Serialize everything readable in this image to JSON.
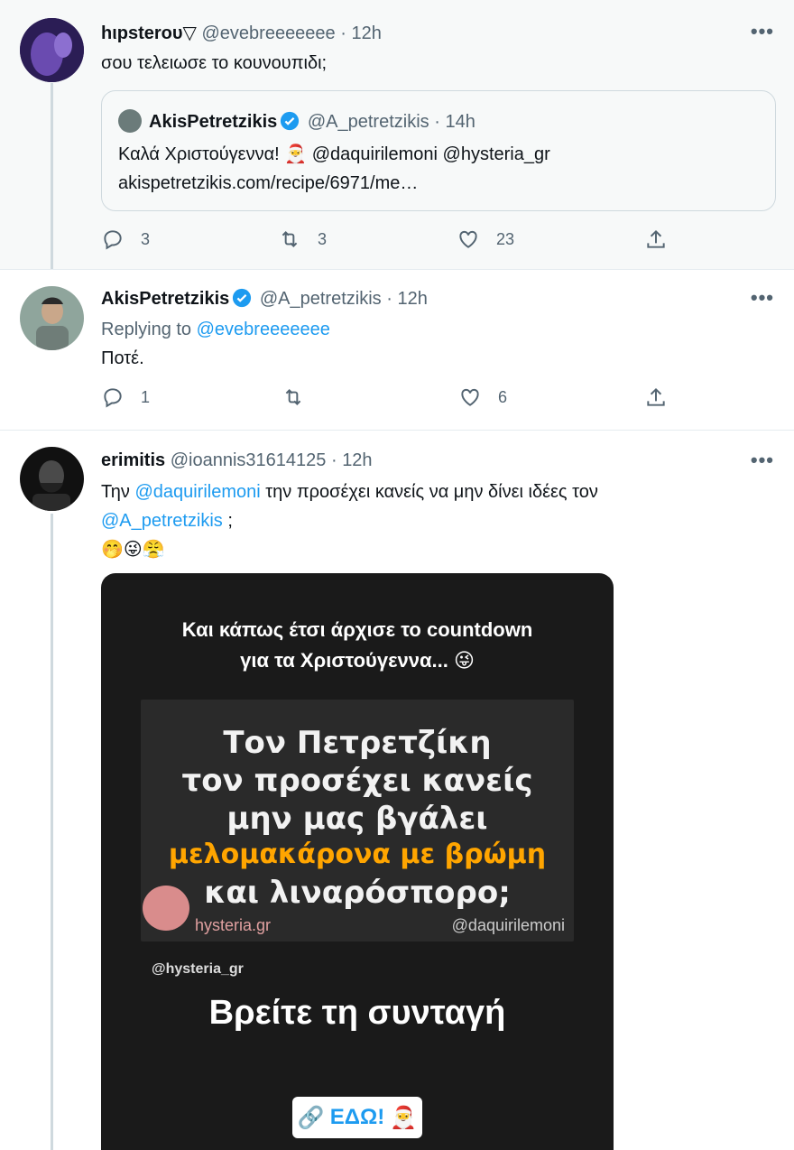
{
  "tweets": [
    {
      "name": "hιpsterου▽",
      "handle": "@evebreeeeeee",
      "time": "12h",
      "text": "σου τελειωσε το κουνουπιδι;",
      "quote": {
        "name": "AkisPetretzikis",
        "handle": "@A_petretzikis",
        "time": "14h",
        "line1": "Καλά Χριστούγεννα! 🎅 @daquirilemoni @hysteria_gr",
        "line2": "akispetretzikis.com/recipe/6971/me…"
      },
      "replies": "3",
      "retweets": "3",
      "likes": "23"
    },
    {
      "name": "AkisPetretzikis",
      "handle": "@A_petretzikis",
      "time": "12h",
      "replying_label": "Replying to",
      "replying_to": "@evebreeeeeee",
      "text": "Ποτέ.",
      "replies": "1",
      "retweets": "",
      "likes": "6"
    },
    {
      "name": "erimitis",
      "handle": "@ioannis31614125",
      "time": "12h",
      "text_pre": "Την",
      "mention1": "@daquirilemoni",
      "text_mid": "την προσέχει κανείς να μην δίνει ιδέες τον",
      "mention2": "@A_petretzikis",
      "text_post": ";",
      "emojis": "🤭😜😤",
      "media": {
        "caption1": "Και κάπως έτσι άρχισε το countdown",
        "caption2": "για τα Χριστούγεννα... 😜",
        "board1": "Τον Πετρετζίκη",
        "board2": "τον προσέχει κανείς",
        "board3": "μην μας βγάλει",
        "board4": "μελομακάρονα με βρώμη",
        "board5": "και λιναρόσπορο;",
        "wm_site": "hysteria.gr",
        "wm_handle": "@daquirilemoni",
        "wm_hysteria": "@hysteria_gr",
        "big_text": "Βρείτε τη συνταγή",
        "button_label": "ΕΔΩ!"
      }
    }
  ],
  "more_label": "•••",
  "sep": "·",
  "colors": {
    "link": "#1d9bf0",
    "muted": "#536471",
    "verified": "#1d9bf0"
  }
}
